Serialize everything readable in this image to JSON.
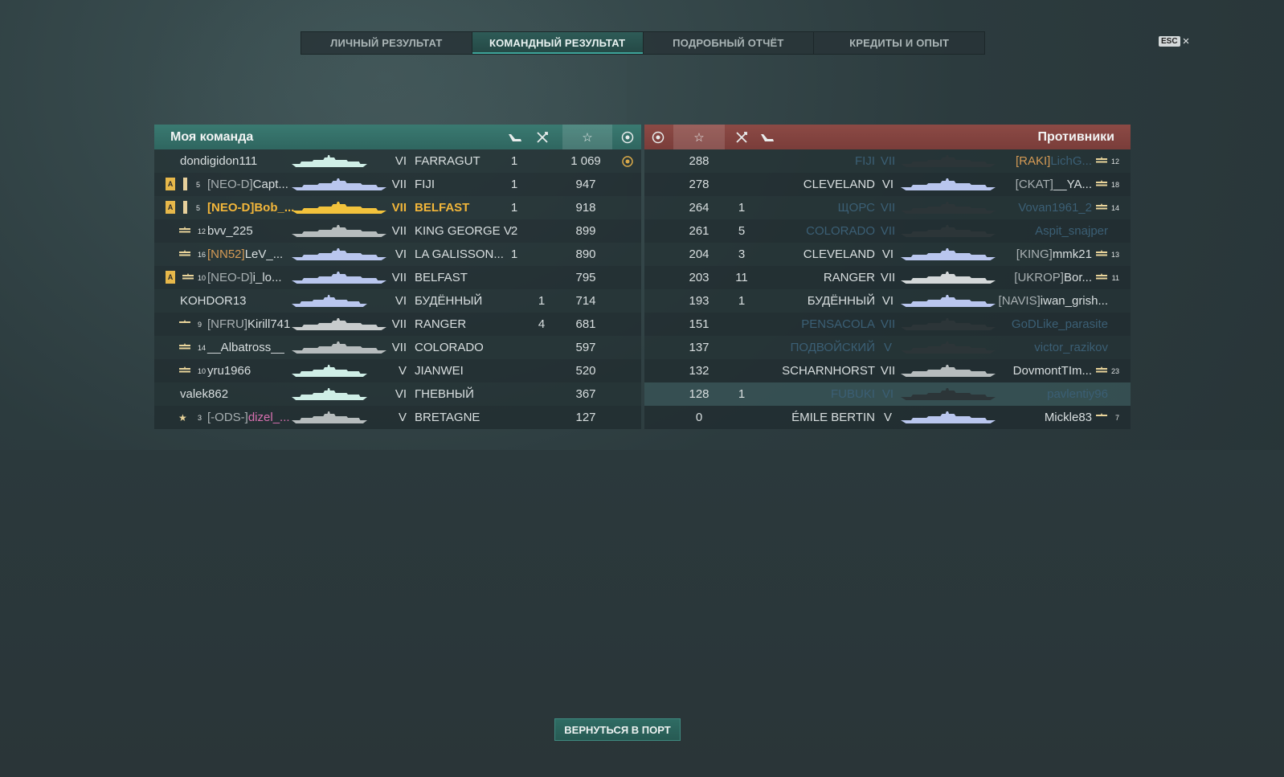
{
  "tabs": [
    {
      "label": "ЛИЧНЫЙ РЕЗУЛЬТАТ",
      "active": false
    },
    {
      "label": "КОМАНДНЫЙ РЕЗУЛЬТАТ",
      "active": true
    },
    {
      "label": "ПОДРОБНЫЙ ОТЧЁТ",
      "active": false
    },
    {
      "label": "КРЕДИТЫ И ОПЫТ",
      "active": false
    }
  ],
  "esc": {
    "key": "ESC",
    "close": "×"
  },
  "my_team": {
    "title": "Моя команда",
    "rows": [
      {
        "badge": "",
        "rank": "",
        "clan": "",
        "name": "dondigidon111",
        "tier": "VI",
        "ship": "FARRAGUT",
        "kills": "1",
        "planes": "",
        "score": "1 069",
        "medal": true,
        "style": "normal",
        "ship_color": "#cfeee6"
      },
      {
        "badge": "A",
        "rank": "5",
        "clan": "[NEO-D]",
        "name": "Capt...",
        "tier": "VII",
        "ship": "FIJI",
        "kills": "1",
        "planes": "",
        "score": "947",
        "medal": false,
        "style": "normal",
        "ship_color": "#b9c6ee"
      },
      {
        "badge": "A",
        "rank": "5",
        "clan": "[NEO-D]",
        "name": "Bob_...",
        "tier": "VII",
        "ship": "BELFAST",
        "kills": "1",
        "planes": "",
        "score": "918",
        "medal": false,
        "style": "gold",
        "ship_color": "#f2c33c"
      },
      {
        "badge": "",
        "rank": "12",
        "clan": "",
        "name": "bvv_225",
        "tier": "VII",
        "ship": "KING GEORGE V",
        "kills": "2",
        "planes": "",
        "score": "899",
        "medal": false,
        "style": "normal",
        "ship_color": "#b6bcbd"
      },
      {
        "badge": "",
        "rank": "16",
        "clan": "[NN52]",
        "name": "LeV_...",
        "tier": "VI",
        "ship": "LA GALISSON...",
        "kills": "1",
        "planes": "",
        "score": "890",
        "medal": false,
        "style": "normal",
        "ship_color": "#b9c6ee"
      },
      {
        "badge": "A",
        "rank": "10",
        "clan": "[NEO-D]",
        "name": "i_lo...",
        "tier": "VII",
        "ship": "BELFAST",
        "kills": "",
        "planes": "",
        "score": "795",
        "medal": false,
        "style": "normal",
        "ship_color": "#b9c6ee"
      },
      {
        "badge": "",
        "rank": "",
        "clan": "",
        "name": "KOHDOR13",
        "tier": "VI",
        "ship": "БУДЁННЫЙ",
        "kills": "",
        "planes": "1",
        "score": "714",
        "medal": false,
        "style": "normal",
        "ship_color": "#b9c6ee"
      },
      {
        "badge": "",
        "rank": "9",
        "clan": "[NFRU]",
        "name": "Kirill741",
        "tier": "VII",
        "ship": "RANGER",
        "kills": "",
        "planes": "4",
        "score": "681",
        "medal": false,
        "style": "normal",
        "ship_color": "#c8cccd"
      },
      {
        "badge": "",
        "rank": "14",
        "clan": "",
        "name": "__Albatross__",
        "tier": "VII",
        "ship": "COLORADO",
        "kills": "",
        "planes": "",
        "score": "597",
        "medal": false,
        "style": "normal",
        "ship_color": "#b6bcbd"
      },
      {
        "badge": "",
        "rank": "10",
        "clan": "",
        "name": "yru1966",
        "tier": "V",
        "ship": "JIANWEI",
        "kills": "",
        "planes": "",
        "score": "520",
        "medal": false,
        "style": "normal",
        "ship_color": "#cfeee6"
      },
      {
        "badge": "",
        "rank": "",
        "clan": "",
        "name": "valek862",
        "tier": "VI",
        "ship": "ГНЕВНЫЙ",
        "kills": "",
        "planes": "",
        "score": "367",
        "medal": false,
        "style": "normal",
        "ship_color": "#cfeee6"
      },
      {
        "badge": "",
        "rank": "3",
        "clan": "[-ODS-]",
        "name": "dizel_...",
        "tier": "V",
        "ship": "BRETAGNE",
        "kills": "",
        "planes": "",
        "score": "127",
        "medal": false,
        "style": "pink",
        "ship_color": "#b6bcbd"
      }
    ]
  },
  "enemies": {
    "title": "Противники",
    "rows": [
      {
        "score": "288",
        "kills": "",
        "ship": "FIJI",
        "tier": "VII",
        "clan": "[RAKI]",
        "name": "LichG...",
        "rank": "12",
        "dead": true,
        "ship_color": "#2c3538"
      },
      {
        "score": "278",
        "kills": "",
        "ship": "CLEVELAND",
        "tier": "VI",
        "clan": "[CKAT]",
        "name": "__YA...",
        "rank": "18",
        "dead": false,
        "ship_color": "#b9c6ee"
      },
      {
        "score": "264",
        "kills": "1",
        "ship": "ЩОРС",
        "tier": "VII",
        "clan": "",
        "name": "Vovan1961_2",
        "rank": "14",
        "dead": true,
        "ship_color": "#2c3538"
      },
      {
        "score": "261",
        "kills": "5",
        "ship": "COLORADO",
        "tier": "VII",
        "clan": "",
        "name": "Aspit_snajper",
        "rank": "",
        "dead": true,
        "ship_color": "#2c3538"
      },
      {
        "score": "204",
        "kills": "3",
        "ship": "CLEVELAND",
        "tier": "VI",
        "clan": "[KING]",
        "name": "mmk21",
        "rank": "13",
        "dead": false,
        "ship_color": "#b9c6ee"
      },
      {
        "score": "203",
        "kills": "11",
        "ship": "RANGER",
        "tier": "VII",
        "clan": "[UKROP]",
        "name": "Bor...",
        "rank": "11",
        "dead": false,
        "ship_color": "#d4d8d9"
      },
      {
        "score": "193",
        "kills": "1",
        "ship": "БУДЁННЫЙ",
        "tier": "VI",
        "clan": "[NAVIS]",
        "name": "iwan_grish...",
        "rank": "",
        "dead": false,
        "ship_color": "#b9c6ee"
      },
      {
        "score": "151",
        "kills": "",
        "ship": "PENSACOLA",
        "tier": "VII",
        "clan": "",
        "name": "GoDLike_parasite",
        "rank": "",
        "dead": true,
        "ship_color": "#2c3538"
      },
      {
        "score": "137",
        "kills": "",
        "ship": "ПОДВОЙСКИЙ",
        "tier": "V",
        "clan": "",
        "name": "victor_razikov",
        "rank": "",
        "dead": true,
        "ship_color": "#2c3538"
      },
      {
        "score": "132",
        "kills": "",
        "ship": "SCHARNHORST",
        "tier": "VII",
        "clan": "",
        "name": "DovmontTIm...",
        "rank": "23",
        "dead": false,
        "ship_color": "#b6bcbd"
      },
      {
        "score": "128",
        "kills": "1",
        "ship": "FUBUKI",
        "tier": "VI",
        "clan": "",
        "name": "pavlentiy96",
        "rank": "",
        "dead": true,
        "ship_color": "#2c3538"
      },
      {
        "score": "0",
        "kills": "",
        "ship": "ÉMILE BERTIN",
        "tier": "V",
        "clan": "",
        "name": "Mickle83",
        "rank": "7",
        "dead": false,
        "ship_color": "#b9c6ee"
      }
    ]
  },
  "icons": {
    "planes": "plane-icon",
    "kills": "crossed-swords-icon",
    "score": "star-icon",
    "medal": "medal-icon"
  },
  "colors": {
    "ally_header": "#347068",
    "enemy_header": "#844541",
    "gold": "#f2b63a",
    "clan_orange": "#d49a55",
    "pink": "#d870b0",
    "dead": "#3b5f75"
  },
  "footer": {
    "return_button": "ВЕРНУТЬСЯ В ПОРТ"
  }
}
